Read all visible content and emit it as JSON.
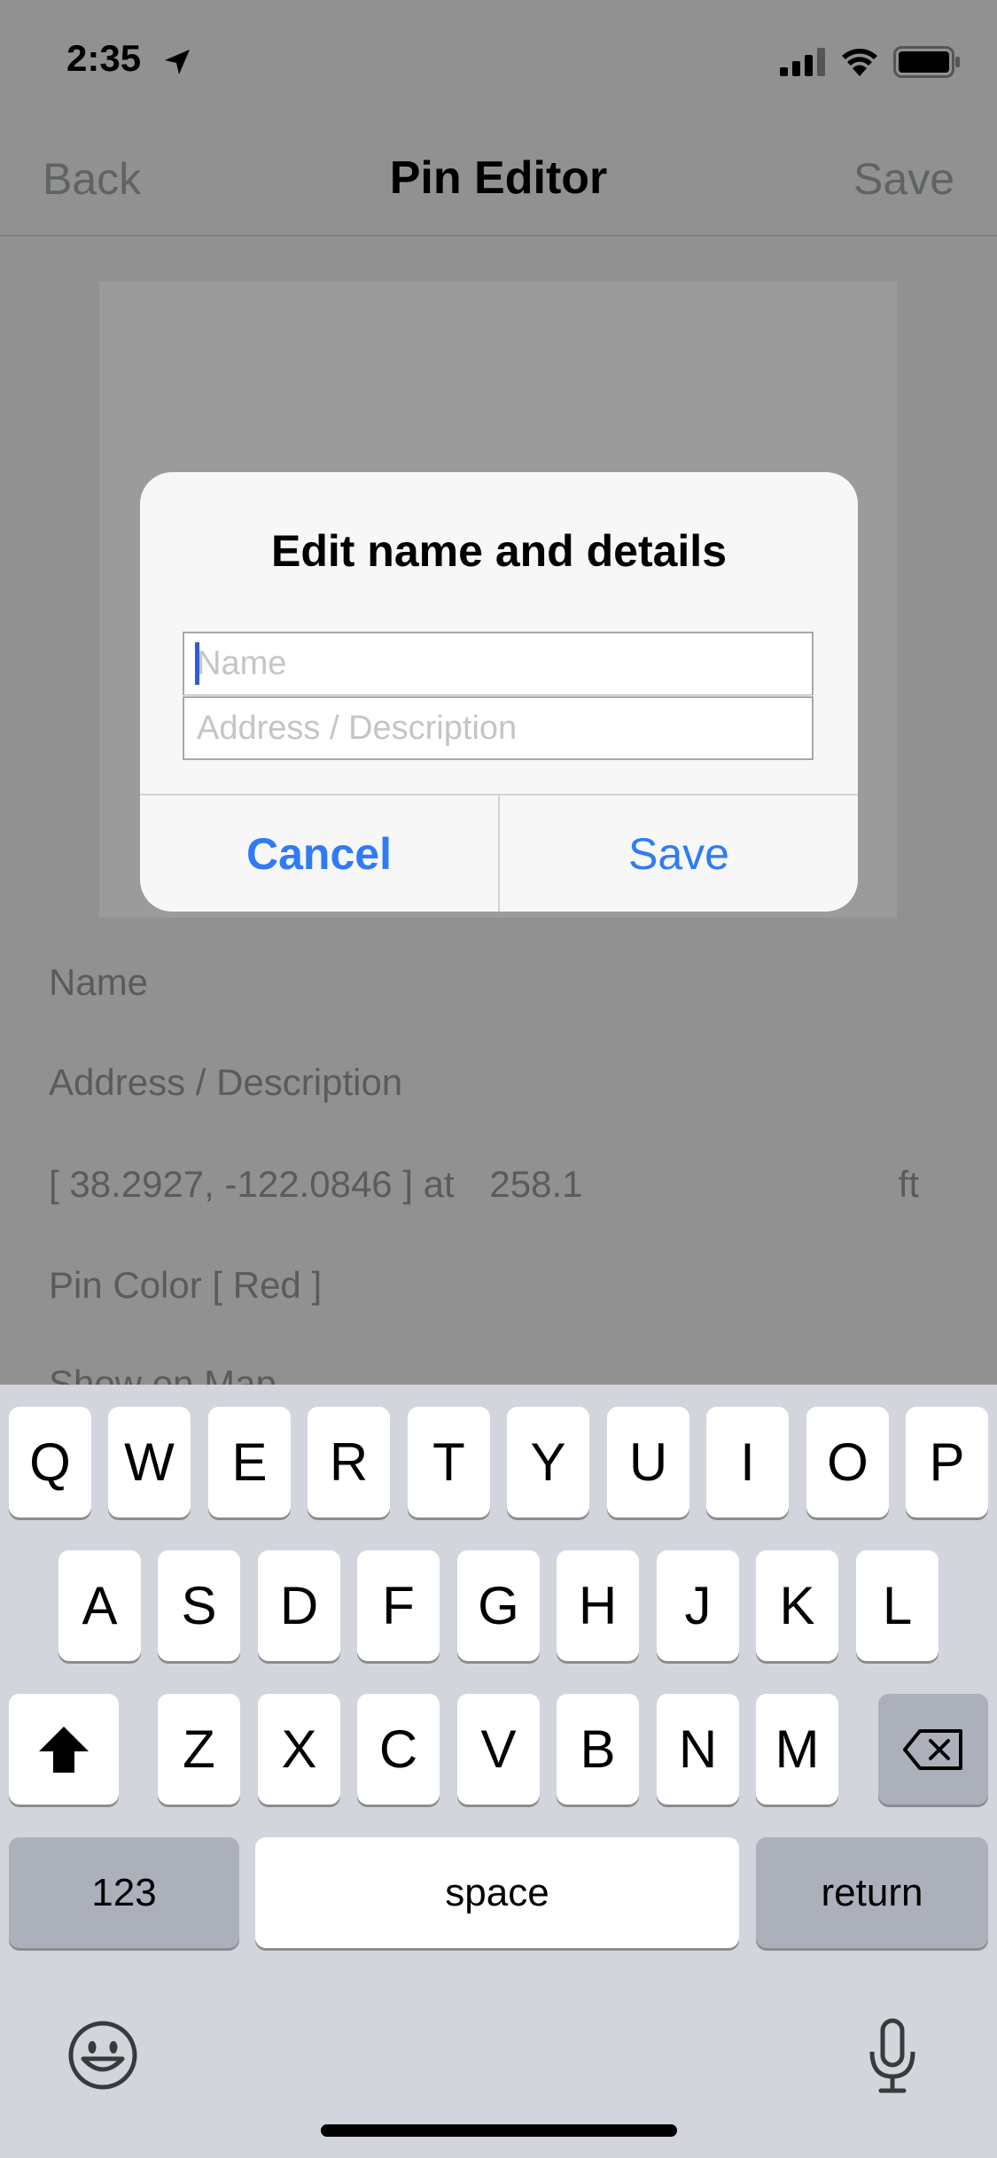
{
  "status_bar": {
    "time": "2:35"
  },
  "nav": {
    "back_label": "Back",
    "title": "Pin Editor",
    "save_label": "Save"
  },
  "content": {
    "name_label": "Name",
    "address_label": "Address / Description",
    "coords_text": "[ 38.2927, -122.0846 ] at",
    "altitude": "258.1",
    "altitude_unit": "ft",
    "pin_color_text": "Pin Color [ Red ]",
    "show_on_map_text": "Show on Map"
  },
  "alert": {
    "title": "Edit name and details",
    "name_placeholder": "Name",
    "name_value": "",
    "address_placeholder": "Address / Description",
    "address_value": "",
    "cancel_label": "Cancel",
    "save_label": "Save"
  },
  "keyboard": {
    "row1": [
      "Q",
      "W",
      "E",
      "R",
      "T",
      "Y",
      "U",
      "I",
      "O",
      "P"
    ],
    "row2": [
      "A",
      "S",
      "D",
      "F",
      "G",
      "H",
      "J",
      "K",
      "L"
    ],
    "row3": [
      "Z",
      "X",
      "C",
      "V",
      "B",
      "N",
      "M"
    ],
    "numbers_label": "123",
    "space_label": "space",
    "return_label": "return"
  },
  "colors": {
    "accent": "#2f7bf6",
    "dim_background": "#919191",
    "keyboard_bg": "#d2d5db"
  }
}
